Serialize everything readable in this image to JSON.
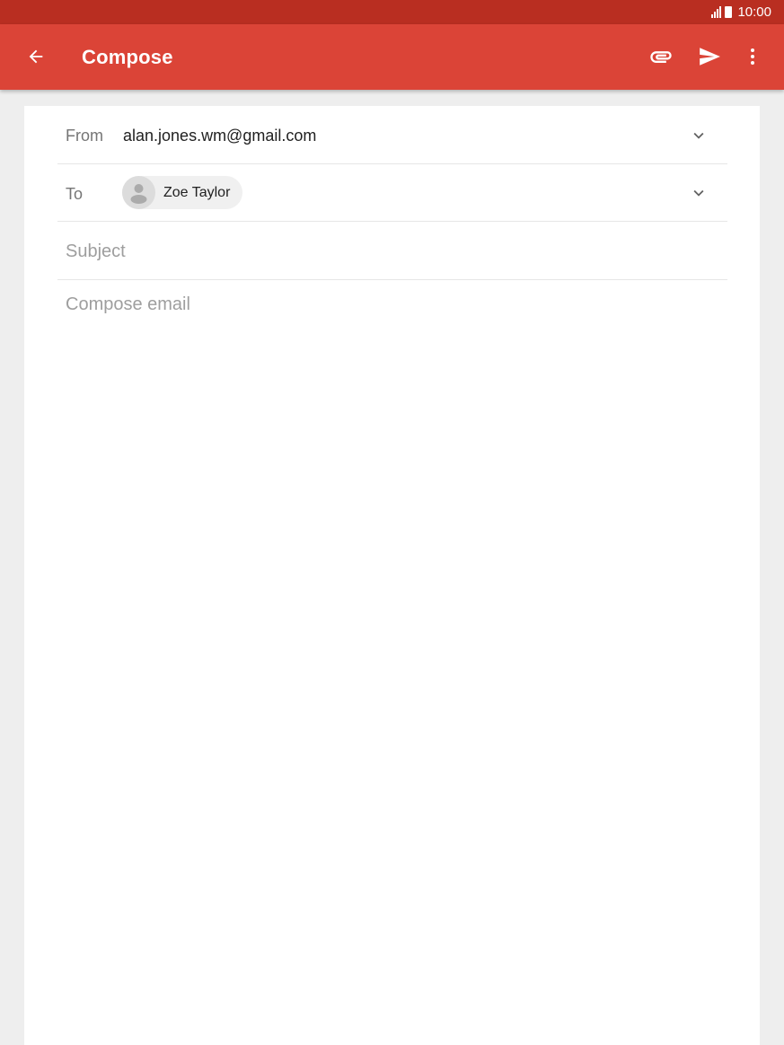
{
  "status_bar": {
    "time": "10:00",
    "signal_icon": "signal-icon",
    "battery_icon": "battery-icon"
  },
  "app_bar": {
    "title": "Compose",
    "back_icon": "arrow-back-icon",
    "attach_icon": "paperclip-icon",
    "send_icon": "send-icon",
    "more_icon": "more-vert-icon",
    "background": "#db4437",
    "status_background": "#b92e21"
  },
  "compose": {
    "from_label": "From",
    "from_value": "alan.jones.wm@gmail.com",
    "to_label": "To",
    "recipients": [
      {
        "name": "Zoe Taylor"
      }
    ],
    "subject_placeholder": "Subject",
    "subject_value": "",
    "body_placeholder": "Compose email",
    "body_value": ""
  }
}
